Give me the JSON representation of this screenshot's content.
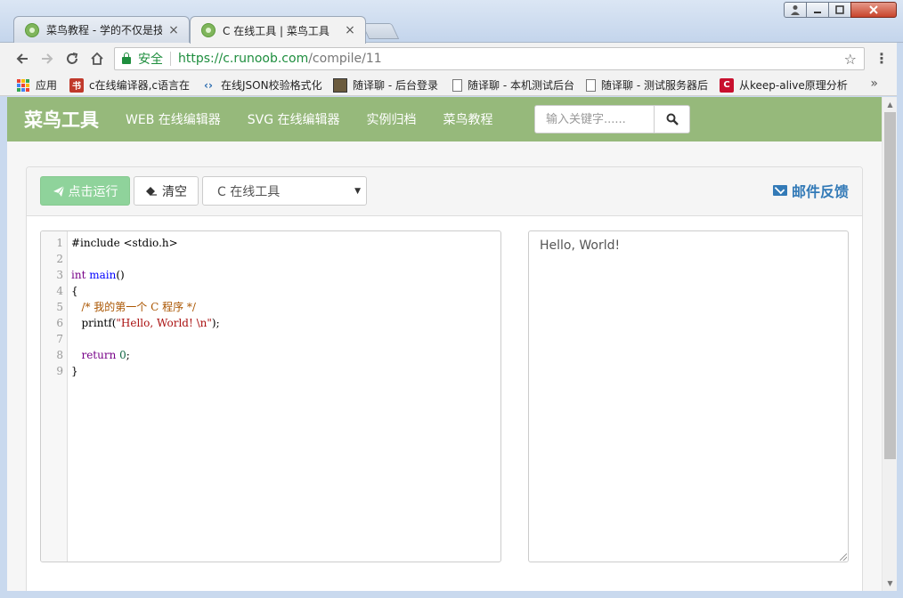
{
  "browser": {
    "tabs": [
      {
        "label": "菜鸟教程 - 学的不仅是技",
        "active": false
      },
      {
        "label": "C 在线工具 | 菜鸟工具",
        "active": true
      }
    ],
    "address": {
      "secure_label": "安全",
      "url_scheme": "https://",
      "url_host": "c.runoob.com",
      "url_path": "/compile/11"
    },
    "bookmarks": [
      {
        "label": "应用",
        "icon": "apps-grid-icon"
      },
      {
        "label": "c在线编译器,c语言在",
        "icon": "book-icon"
      },
      {
        "label": "在线JSON校验格式化",
        "icon": "code-icon"
      },
      {
        "label": "随译聊 - 后台登录",
        "icon": "image-icon"
      },
      {
        "label": "随译聊 - 本机测试后台",
        "icon": "page-icon"
      },
      {
        "label": "随译聊 - 测试服务器后",
        "icon": "page-icon"
      },
      {
        "label": "从keep-alive原理分析",
        "icon": "c-brand-icon"
      }
    ],
    "bookmarks_more": "»"
  },
  "site": {
    "brand": "菜鸟工具",
    "nav": [
      "WEB 在线编辑器",
      "SVG 在线编辑器",
      "实例归档",
      "菜鸟教程"
    ],
    "search_placeholder": "输入关键字......"
  },
  "toolbar": {
    "run_label": "点击运行",
    "clear_label": "清空",
    "language_selected": "C 在线工具",
    "feedback_label": "邮件反馈"
  },
  "editor": {
    "lines": [
      {
        "n": "1",
        "text": "#include <stdio.h>"
      },
      {
        "n": "2",
        "text": ""
      },
      {
        "n": "3",
        "text": "int main()"
      },
      {
        "n": "4",
        "text": "{"
      },
      {
        "n": "5",
        "text": "   /* 我的第一个 C 程序 */"
      },
      {
        "n": "6",
        "text": "   printf(\"Hello, World! \\n\");"
      },
      {
        "n": "7",
        "text": ""
      },
      {
        "n": "8",
        "text": "   return 0;"
      },
      {
        "n": "9",
        "text": "}"
      }
    ]
  },
  "output": {
    "text": "Hello, World!"
  },
  "colors": {
    "navbar": "#96b97b",
    "run_button": "#8fd39b",
    "feedback_link": "#337ab7"
  }
}
